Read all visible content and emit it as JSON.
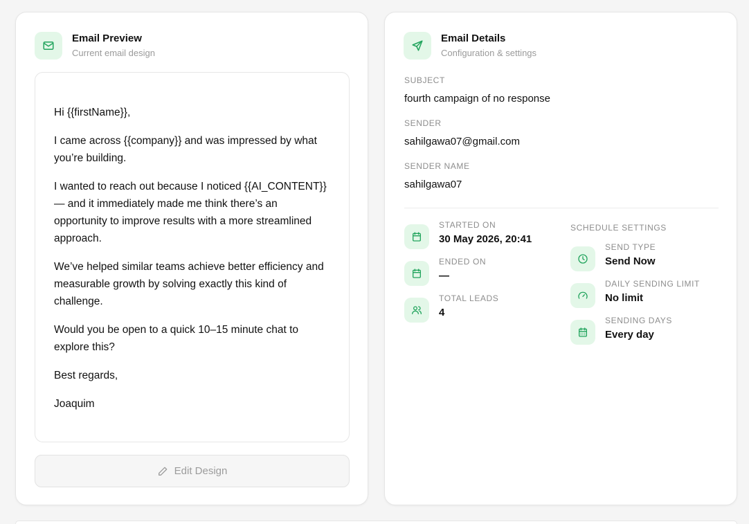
{
  "preview": {
    "title": "Email Preview",
    "subtitle": "Current email design",
    "paragraphs": [
      "Hi {{firstName}},",
      "I came across {{company}} and was impressed by what you’re building.",
      "I wanted to reach out because I noticed {{AI_CONTENT}} — and it immediately made me think there’s an opportunity to improve results with a more streamlined approach.",
      "We’ve helped similar teams achieve better efficiency and measurable growth by solving exactly this kind of challenge.",
      "Would you be open to a quick 10–15 minute chat to explore this?",
      "Best regards,",
      "Joaquim"
    ],
    "edit_button_label": "Edit Design"
  },
  "details": {
    "title": "Email Details",
    "subtitle": "Configuration & settings",
    "subject_label": "SUBJECT",
    "subject_value": "fourth campaign of no response",
    "sender_label": "SENDER",
    "sender_value": "sahilgawa07@gmail.com",
    "sender_name_label": "SENDER NAME",
    "sender_name_value": "sahilgawa07",
    "started_on_label": "STARTED ON",
    "started_on_value": "30 May 2026, 20:41",
    "ended_on_label": "ENDED ON",
    "ended_on_value": "—",
    "total_leads_label": "TOTAL LEADS",
    "total_leads_value": "4",
    "schedule_title": "SCHEDULE SETTINGS",
    "send_type_label": "SEND TYPE",
    "send_type_value": "Send Now",
    "daily_limit_label": "DAILY SENDING LIMIT",
    "daily_limit_value": "No limit",
    "sending_days_label": "SENDING DAYS",
    "sending_days_value": "Every day"
  },
  "icons": {
    "preview_header": "mail-icon",
    "details_header": "send-icon",
    "edit": "pencil-icon",
    "started_on": "calendar-icon",
    "ended_on": "calendar-icon",
    "total_leads": "users-icon",
    "send_type": "clock-icon",
    "daily_limit": "gauge-icon",
    "sending_days": "calendar-grid-icon"
  },
  "colors": {
    "accent": "#22a45d",
    "accent_bg": "#e3f7e8"
  }
}
